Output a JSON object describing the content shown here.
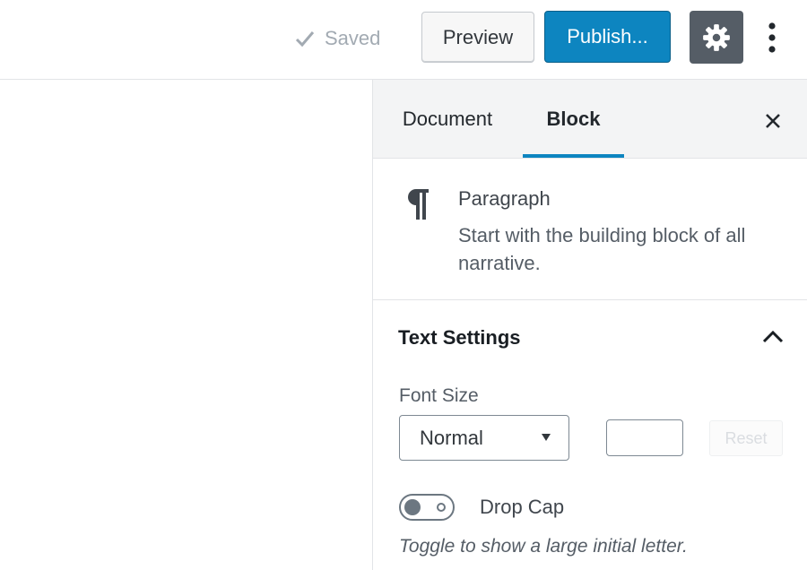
{
  "toolbar": {
    "saved_label": "Saved",
    "saved_icon": "checkmark-icon",
    "preview_label": "Preview",
    "publish_label": "Publish...",
    "settings_icon": "gear-icon",
    "more_icon": "vertical-ellipsis-icon",
    "colors": {
      "publish": "#0d85c0",
      "settings_bg": "#555d66"
    }
  },
  "sidebar": {
    "tabs": [
      {
        "label": "Document",
        "active": false
      },
      {
        "label": "Block",
        "active": true
      }
    ],
    "close_icon": "close-icon",
    "block": {
      "icon": "pilcrow-icon",
      "title": "Paragraph",
      "description": "Start with the building block of all narrative."
    },
    "text_settings": {
      "title": "Text Settings",
      "expanded": true,
      "font_size_label": "Font Size",
      "font_size_selected": "Normal",
      "custom_size_value": "",
      "reset_label": "Reset",
      "drop_cap_label": "Drop Cap",
      "drop_cap_enabled": false,
      "drop_cap_help": "Toggle to show a large initial letter."
    }
  }
}
